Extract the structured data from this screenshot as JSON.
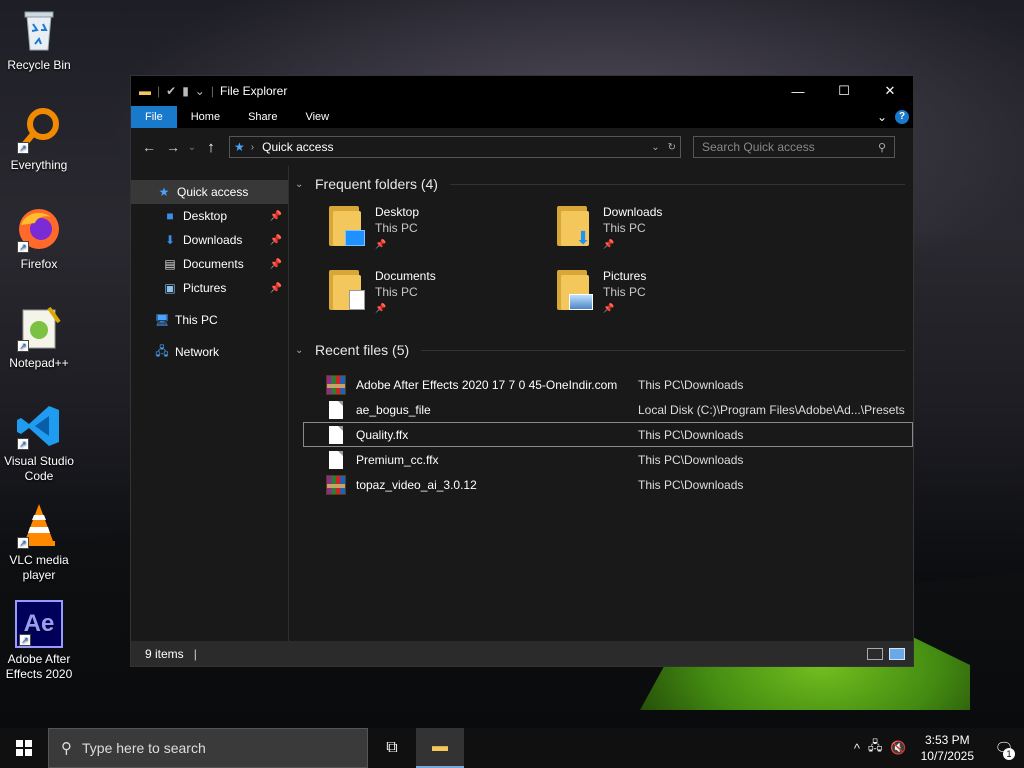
{
  "desktop": {
    "icons": [
      {
        "label": "Recycle Bin",
        "icon": "recycle-bin-icon"
      },
      {
        "label": "Everything",
        "icon": "everything-search-icon"
      },
      {
        "label": "Firefox",
        "icon": "firefox-icon"
      },
      {
        "label": "Notepad++",
        "icon": "notepad-plus-plus-icon"
      },
      {
        "label": "Visual Studio Code",
        "icon": "vscode-icon"
      },
      {
        "label": "VLC media player",
        "icon": "vlc-icon"
      },
      {
        "label": "Adobe After Effects 2020",
        "icon": "after-effects-icon",
        "glyph": "Ae"
      }
    ]
  },
  "window": {
    "title": "File Explorer",
    "controls": {
      "minimize": "—",
      "maximize": "☐",
      "close": "✕"
    }
  },
  "ribbon": {
    "tabs": [
      "File",
      "Home",
      "Share",
      "View"
    ],
    "help": "?"
  },
  "navbar": {
    "back": "←",
    "forward": "→",
    "recent": "⌄",
    "up": "↑",
    "address": "Quick access",
    "search_placeholder": "Search Quick access"
  },
  "sidebar": {
    "quick_access": "Quick access",
    "pinned": [
      {
        "label": "Desktop",
        "icon": "desktop-folder-icon"
      },
      {
        "label": "Downloads",
        "icon": "downloads-folder-icon"
      },
      {
        "label": "Documents",
        "icon": "documents-folder-icon"
      },
      {
        "label": "Pictures",
        "icon": "pictures-folder-icon"
      }
    ],
    "this_pc": "This PC",
    "network": "Network"
  },
  "main": {
    "frequent_header": "Frequent folders (4)",
    "folders": [
      {
        "name": "Desktop",
        "location": "This PC"
      },
      {
        "name": "Downloads",
        "location": "This PC"
      },
      {
        "name": "Documents",
        "location": "This PC"
      },
      {
        "name": "Pictures",
        "location": "This PC"
      }
    ],
    "recent_header": "Recent files (5)",
    "files": [
      {
        "name": "Adobe After Effects 2020 17 7 0 45-OneIndir.com",
        "path": "This PC\\Downloads",
        "type": "archive"
      },
      {
        "name": "ae_bogus_file",
        "path": "Local Disk (C:)\\Program Files\\Adobe\\Ad...\\Presets",
        "type": "doc"
      },
      {
        "name": "Quality.ffx",
        "path": "This PC\\Downloads",
        "type": "doc"
      },
      {
        "name": "Premium_cc.ffx",
        "path": "This PC\\Downloads",
        "type": "doc"
      },
      {
        "name": "topaz_video_ai_3.0.12",
        "path": "This PC\\Downloads",
        "type": "archive"
      }
    ]
  },
  "status": {
    "items": "9 items"
  },
  "taskbar": {
    "search_placeholder": "Type here to search",
    "time": "3:53 PM",
    "date": "10/7/2025",
    "notification_count": "1"
  },
  "colors": {
    "accent": "#1979ca",
    "window_bg": "#191919",
    "folder_yellow": "#f3c75c"
  }
}
